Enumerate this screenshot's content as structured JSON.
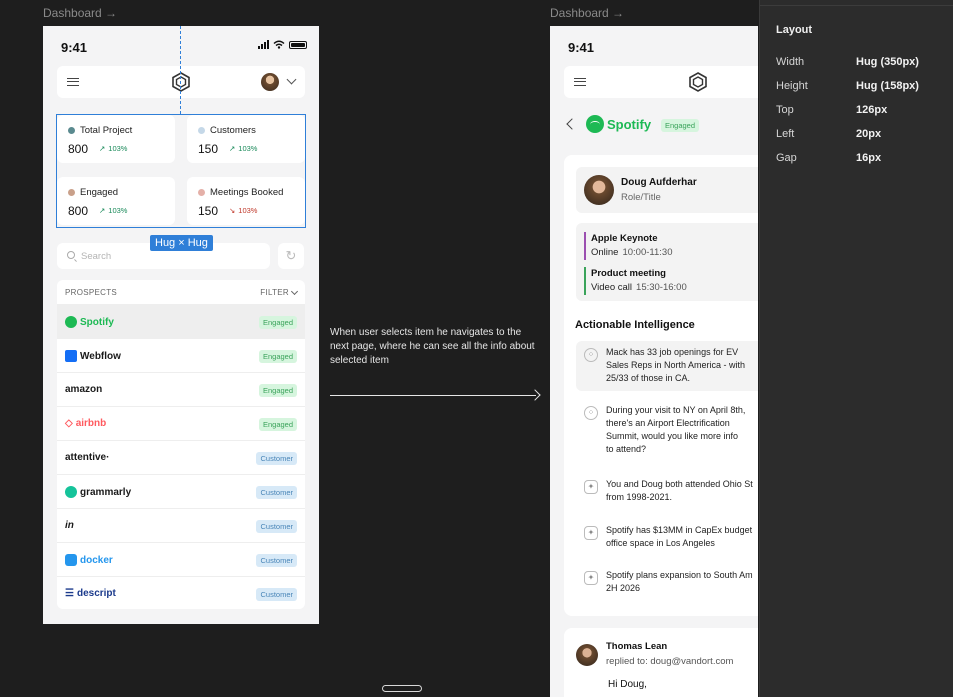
{
  "canvas": {
    "frame_labels": [
      "Dashboard →",
      "Dashboard →"
    ],
    "note": "When user selects item he navigates to the next page, where he can see all the info about selected item"
  },
  "phone1": {
    "time": "9:41",
    "stats": [
      {
        "label": "Total Project",
        "value": "800",
        "trend": "103%",
        "direction": "up",
        "dot": "#5a8a8f"
      },
      {
        "label": "Customers",
        "value": "150",
        "trend": "103%",
        "direction": "up",
        "dot": "#c5d8e8"
      },
      {
        "label": "Engaged",
        "value": "800",
        "trend": "103%",
        "direction": "up",
        "dot": "#c9a08a"
      },
      {
        "label": "Meetings Booked",
        "value": "150",
        "trend": "103%",
        "direction": "down",
        "dot": "#e4b0a8"
      }
    ],
    "selection_badge": "Hug × Hug",
    "search_placeholder": "Search",
    "prospects_title": "PROSPECTS",
    "filter_label": "FILTER",
    "prospects": [
      {
        "name": "Spotify",
        "status": "Engaged",
        "color": "#1db954"
      },
      {
        "name": "Webflow",
        "status": "Engaged",
        "color": "#1a1a1a"
      },
      {
        "name": "amazon",
        "status": "Engaged",
        "color": "#1a1a1a"
      },
      {
        "name": "airbnb",
        "status": "Engaged",
        "color": "#ff5a5f"
      },
      {
        "name": "attentive·",
        "status": "Customer",
        "color": "#1a1a1a"
      },
      {
        "name": "grammarly",
        "status": "Customer",
        "color": "#1a1a1a"
      },
      {
        "name": "in",
        "status": "Customer",
        "color": "#1a1a1a"
      },
      {
        "name": "docker",
        "status": "Customer",
        "color": "#2496ed"
      },
      {
        "name": "descript",
        "status": "Customer",
        "color": "#1b3a8c"
      }
    ]
  },
  "phone2": {
    "time": "9:41",
    "brand": "Spotify",
    "status_tag": "Engaged",
    "contact": {
      "name": "Doug Aufderhar",
      "role": "Role/Title"
    },
    "meetings": [
      {
        "title": "Apple Keynote",
        "mode": "Online",
        "time": "10:00-11:30",
        "color": "#9b4fb0"
      },
      {
        "title": "Product meeting",
        "mode": "Video call",
        "time": "15:30-16:00",
        "color": "#3aa35a"
      }
    ],
    "ai_title": "Actionable Intelligence",
    "ai_items": [
      {
        "lines": [
          "Mack has 33 job openings for EV",
          "Sales Reps in North America - with",
          "25/33 of those in CA."
        ],
        "icon": "loader-icon"
      },
      {
        "lines": [
          "During your visit to NY on April 8th,",
          "there's an Airport Electrification",
          "Summit, would you like more info",
          "to attend?"
        ],
        "icon": "loader-icon"
      },
      {
        "lines": [
          "You and Doug both attended Ohio St",
          "from 1998-2021."
        ],
        "icon": "sparkle-icon"
      },
      {
        "lines": [
          "Spotify has $13MM in CapEx budget",
          "office space in Los Angeles"
        ],
        "icon": "sparkle-icon"
      },
      {
        "lines": [
          "Spotify plans expansion to South Am",
          "2H 2026"
        ],
        "icon": "sparkle-icon"
      }
    ],
    "email": {
      "sender": "Thomas Lean",
      "replied": "replied to: doug@vandort.com",
      "greeting": "Hi Doug,"
    }
  },
  "inspector": {
    "title": "Layout",
    "props": [
      {
        "label": "Width",
        "value": "Hug (350px)"
      },
      {
        "label": "Height",
        "value": "Hug (158px)"
      },
      {
        "label": "Top",
        "value": "126px"
      },
      {
        "label": "Left",
        "value": "20px"
      },
      {
        "label": "Gap",
        "value": "16px"
      }
    ]
  }
}
